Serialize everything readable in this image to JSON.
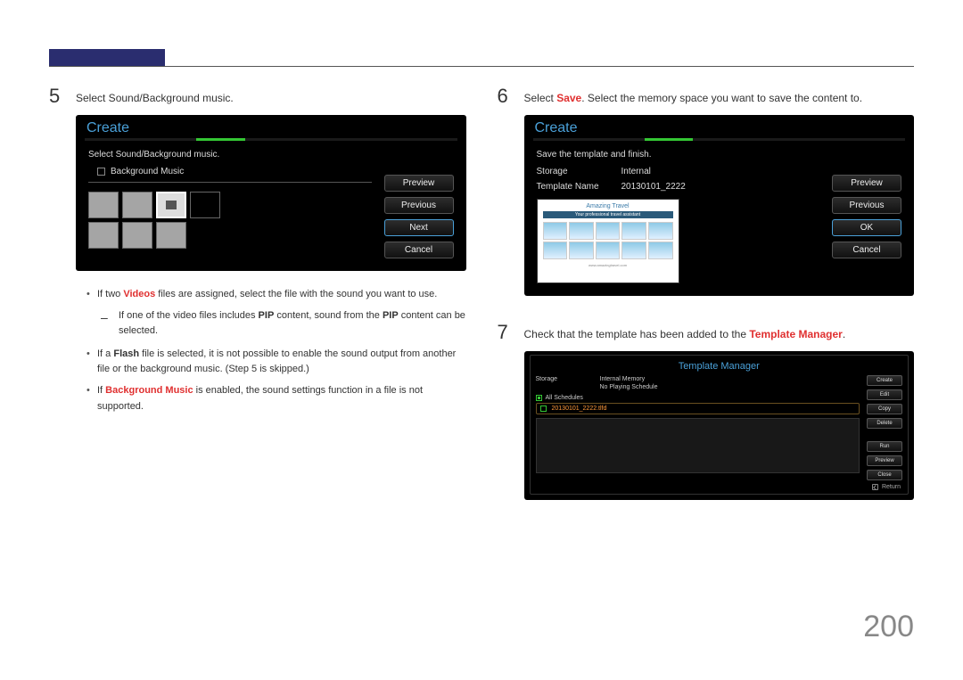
{
  "pageNumber": "200",
  "left": {
    "step5": {
      "num": "5",
      "text": "Select Sound/Background music.",
      "screenshot": {
        "title": "Create",
        "subtitle": "Select Sound/Background music.",
        "checkbox_label": "Background Music",
        "buttons": {
          "preview": "Preview",
          "previous": "Previous",
          "next": "Next",
          "cancel": "Cancel"
        }
      },
      "bullets": {
        "b1_pre": "If two ",
        "b1_videos": "Videos",
        "b1_post": " files are assigned, select the file with the sound you want to use.",
        "sub_pre": "If one of the video files includes ",
        "sub_pip": "PIP",
        "sub_mid": " content, sound from the ",
        "sub_post": " content can be selected.",
        "b2_pre": "If a ",
        "b2_flash": "Flash",
        "b2_post": " file is selected, it is not possible to enable the sound output from another file or the background music. (Step 5 is skipped.)",
        "b3_pre": "If ",
        "b3_bg": "Background Music",
        "b3_post": " is enabled, the sound settings function in a file is not supported."
      }
    }
  },
  "right": {
    "step6": {
      "num": "6",
      "text_pre": "Select ",
      "text_save": "Save",
      "text_post": ". Select the memory space you want to save the content to.",
      "screenshot": {
        "title": "Create",
        "subtitle": "Save the template and finish.",
        "storage_k": "Storage",
        "storage_v": "Internal",
        "tname_k": "Template Name",
        "tname_v": "20130101_2222",
        "preview": {
          "title": "Amazing Travel",
          "sub": "Your professional travel assistant",
          "footer": "www.amazingtravel.com"
        },
        "buttons": {
          "preview": "Preview",
          "previous": "Previous",
          "ok": "OK",
          "cancel": "Cancel"
        }
      }
    },
    "step7": {
      "num": "7",
      "text_pre": "Check that the template has been added to the ",
      "text_tm": "Template Manager",
      "text_post": ".",
      "screenshot": {
        "title": "Template Manager",
        "storage_k": "Storage",
        "storage_v": "Internal Memory",
        "noschedule": "No Playing Schedule",
        "all_sched": "All Schedules",
        "file": "20130101_2222.tlfd",
        "buttons": {
          "create": "Create",
          "edit": "Edit",
          "copy": "Copy",
          "delete": "Delete",
          "run": "Run",
          "preview": "Preview",
          "close": "Close"
        },
        "return": "Return"
      }
    }
  }
}
